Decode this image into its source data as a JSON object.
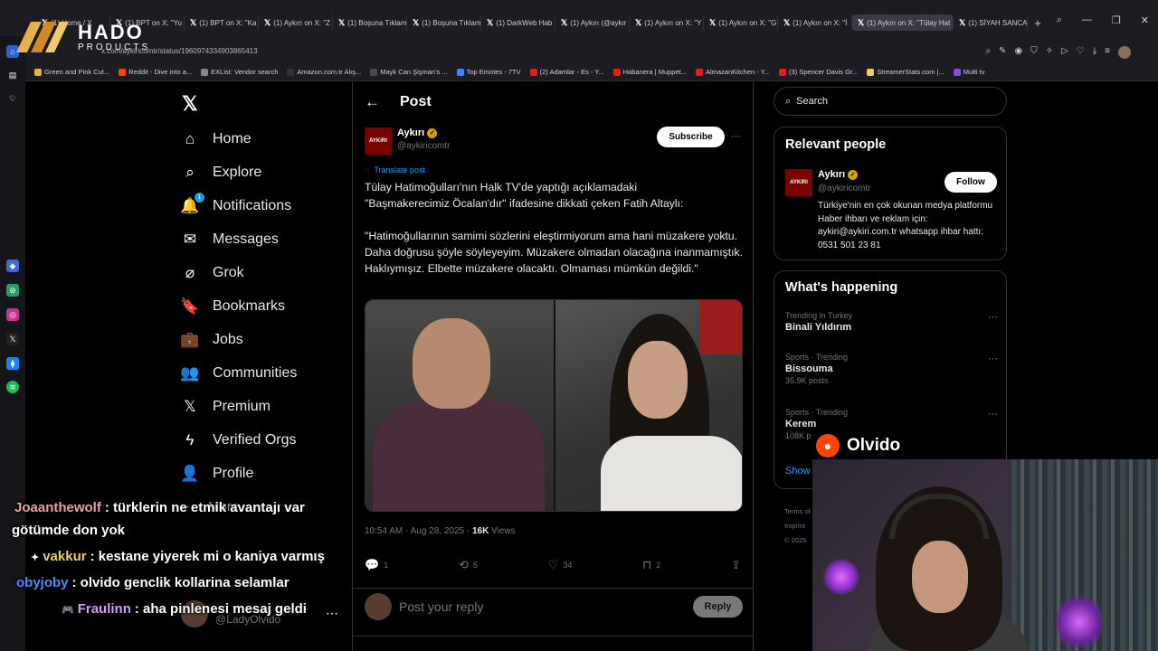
{
  "browser": {
    "tabs": [
      {
        "label": "(1) Home / X"
      },
      {
        "label": "(1) BPT on X: \"Yu"
      },
      {
        "label": "(1) BPT on X: \"Ka"
      },
      {
        "label": "(1) Aykırı on X: \"Z"
      },
      {
        "label": "(1) Boşuna Tıklam"
      },
      {
        "label": "(1) Boşuna Tıklam"
      },
      {
        "label": "(1) DarkWeb Hab"
      },
      {
        "label": "(1) Aykırı (@aykır"
      },
      {
        "label": "(1) Aykırı on X: \"Y"
      },
      {
        "label": "(1) Aykırı on X: \"G"
      },
      {
        "label": "(1) Aykırı on X: \"İ"
      },
      {
        "label": "(1) Aykırı on X: \"Tülay Hat"
      },
      {
        "label": "(1) SİYAH SANCA"
      }
    ],
    "new_tab": "+",
    "url": "x.com/aykiricomtr/status/1960974334903865413",
    "bookmarks": [
      {
        "label": "Green and Pink Cut..."
      },
      {
        "label": "Reddit - Dive into a..."
      },
      {
        "label": "EXList: Vendor search"
      },
      {
        "label": "Amazon.com.tr Alış..."
      },
      {
        "label": "Mayk Can Şişman's ..."
      },
      {
        "label": "Top Emotes - 7TV"
      },
      {
        "label": "(2) Adamlar - Es - Y..."
      },
      {
        "label": "Habanera | Muppet..."
      },
      {
        "label": "AlmazanKitchen - Y..."
      },
      {
        "label": "(3) Spencer Davis Gr..."
      },
      {
        "label": "StreamerStats.com |..."
      },
      {
        "label": "Multi tv"
      }
    ]
  },
  "overlay_logo": {
    "title": "HADO",
    "subtitle": "PRODUCTS"
  },
  "x_nav": {
    "items": [
      {
        "label": "Home",
        "icon": "home-icon",
        "glyph": "⌂"
      },
      {
        "label": "Explore",
        "icon": "search-icon",
        "glyph": "⌕"
      },
      {
        "label": "Notifications",
        "icon": "bell-icon",
        "glyph": "🔔"
      },
      {
        "label": "Messages",
        "icon": "mail-icon",
        "glyph": "✉"
      },
      {
        "label": "Grok",
        "icon": "grok-icon",
        "glyph": "⌀"
      },
      {
        "label": "Bookmarks",
        "icon": "bookmark-icon",
        "glyph": "🔖"
      },
      {
        "label": "Jobs",
        "icon": "briefcase-icon",
        "glyph": "💼"
      },
      {
        "label": "Communities",
        "icon": "people-icon",
        "glyph": "👥"
      },
      {
        "label": "Premium",
        "icon": "x-icon",
        "glyph": "𝕏"
      },
      {
        "label": "Verified Orgs",
        "icon": "lightning-icon",
        "glyph": "ϟ"
      },
      {
        "label": "Profile",
        "icon": "person-icon",
        "glyph": "👤"
      }
    ],
    "notification_count": "1",
    "more_label": "More",
    "account_handle": "@LadyOlvido"
  },
  "post": {
    "header_title": "Post",
    "author_name": "Aykırı",
    "author_handle": "@aykiricomtr",
    "avatar_text": "AYKIRI",
    "subscribe_label": "Subscribe",
    "translate_label": "Translate post",
    "text": "Tülay Hatimoğulları'nın Halk TV'de yaptığı açıklamadaki\n\"Başmakerecimiz Öcalan'dır\" ifadesine dikkati çeken Fatih Altaylı:\n\n\"Hatimoğullarının samimi sözlerini eleştirmiyorum ama hani müzakere yoktu. Daha doğrusu şöyle söyleyeyim. Müzakere olmadan olacağına inanmamıştık. Haklıymışız. Elbette müzakere olacaktı. Olmaması mümkün değildi.\"",
    "time": "10:54 AM · Aug 28, 2025 · ",
    "views_count": "16K",
    "views_label": " Views",
    "replies": "1",
    "reposts": "5",
    "likes": "34",
    "bookmarks": "2",
    "reply_placeholder": "Post your reply",
    "reply_button": "Reply"
  },
  "sidebar": {
    "search_placeholder": "Search",
    "relevant_title": "Relevant people",
    "relevant_name": "Aykırı",
    "relevant_handle": "@aykiricomtr",
    "follow_label": "Follow",
    "relevant_bio": "Türkiye'nin en çok okunan medya platformu Haber ihbarı ve reklam için: aykiri@aykiri.com.tr whatsapp ihbar hattı: 0531 501 23 81",
    "happening_title": "What's happening",
    "trends": [
      {
        "meta": "Trending in Turkey",
        "name": "Binali Yıldırım",
        "count": ""
      },
      {
        "meta": "Sports · Trending",
        "name": "Bissouma",
        "count": "35.9K posts"
      },
      {
        "meta": "Sports · Trending",
        "name": "Kerem",
        "count": "108K p"
      }
    ],
    "show_more": "Show",
    "footer": [
      "Terms of",
      "Imprint",
      "© 2025"
    ]
  },
  "stream": {
    "streamer_name": "Olvido",
    "chat": [
      {
        "user": "Joaanthewolf",
        "color": "#f0a0a0",
        "text": ": türklerin ne etmik avantajı var"
      },
      {
        "user": "",
        "color": "#ffffff",
        "text": "götümde don yok"
      },
      {
        "user": "vakkur",
        "color": "#e8d24a",
        "text": ": kestane yiyerek mi o kaniya varmış"
      },
      {
        "user": "obyjoby",
        "color": "#4a8cff",
        "text": ": olvido genclik kollarina selamlar"
      },
      {
        "user": "Fraulinn",
        "color": "#d79bff",
        "text": ": aha pinlenesi mesaj geldi"
      }
    ]
  }
}
